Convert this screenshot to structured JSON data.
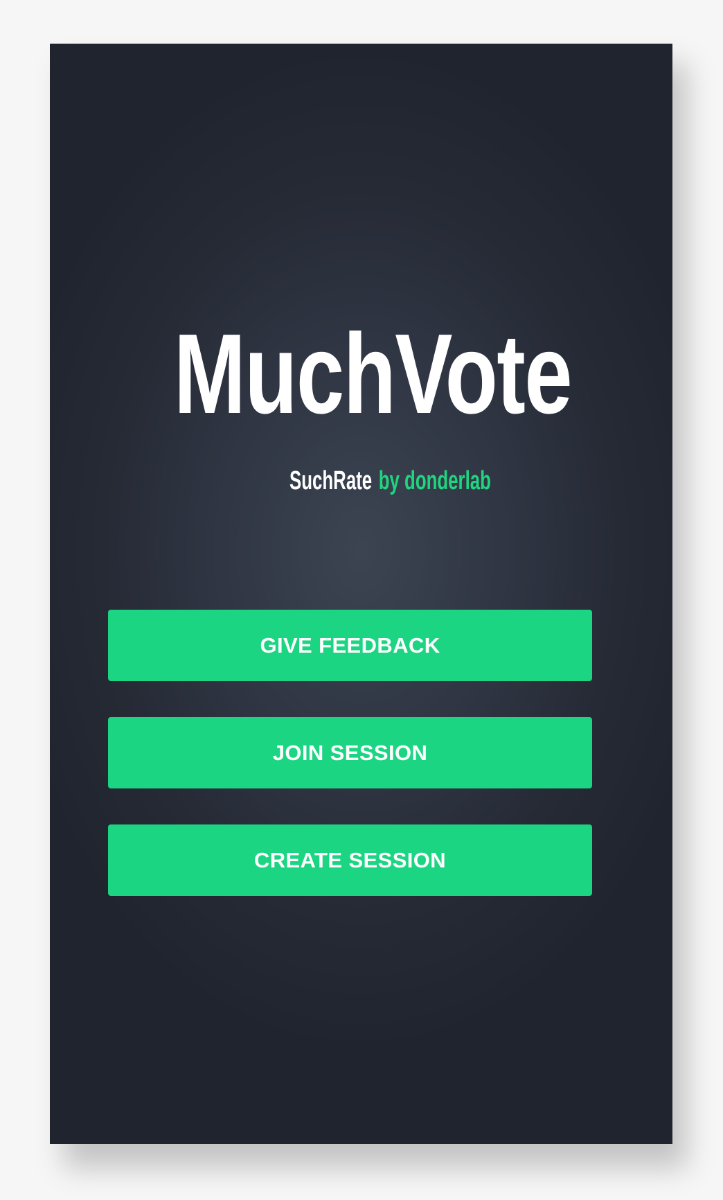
{
  "app": {
    "title": "MuchVote",
    "subtitle_brand": "SuchRate",
    "subtitle_byline": "by donderlab"
  },
  "actions": {
    "give_feedback": "GIVE FEEDBACK",
    "join_session": "JOIN SESSION",
    "create_session": "CREATE SESSION"
  },
  "theme": {
    "background": "#2b303b",
    "accent": "#1bd582",
    "text": "#ffffff"
  }
}
